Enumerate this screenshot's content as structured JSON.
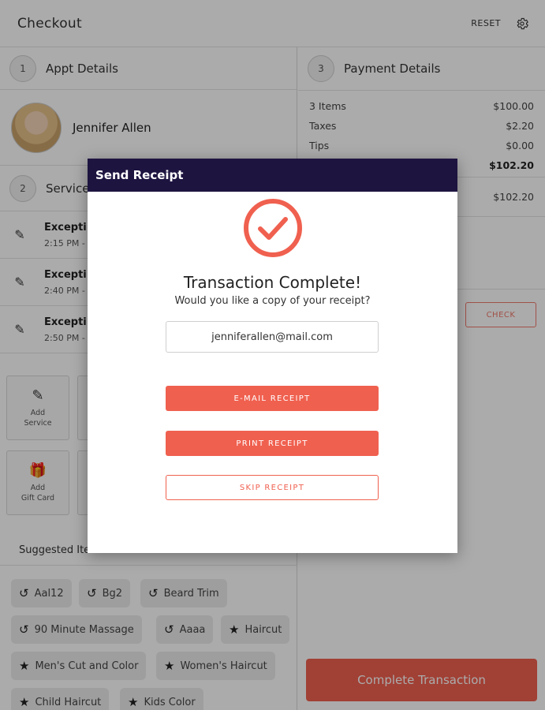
{
  "header": {
    "title": "Checkout",
    "reset_label": "RESET",
    "settings_icon": "gear-icon"
  },
  "appt": {
    "step": "1",
    "title": "Appt Details",
    "client_name": "Jennifer Allen"
  },
  "services": {
    "step": "2",
    "title": "Services",
    "items": [
      {
        "name": "Excepti",
        "time": "2:15 PM -"
      },
      {
        "name": "Excepti",
        "time": "2:40 PM -"
      },
      {
        "name": "Excepti",
        "time": "2:50 PM -"
      }
    ]
  },
  "tiles": [
    {
      "label_line1": "Add",
      "label_line2": "Service",
      "icon": "hairdryer-icon"
    },
    {
      "label_line1": "Add",
      "label_line2": "Gift Card",
      "icon": "gift-card-icon"
    }
  ],
  "suggested": {
    "title": "Suggested Items",
    "chips": [
      {
        "label": "Aal12",
        "icon": "history-icon"
      },
      {
        "label": "Bg2",
        "icon": "history-icon"
      },
      {
        "label": "Beard Trim",
        "icon": "history-icon"
      },
      {
        "label": "90 Minute Massage",
        "icon": "history-icon"
      },
      {
        "label": "Aaaa",
        "icon": "history-icon"
      },
      {
        "label": "Haircut",
        "icon": "star-icon"
      },
      {
        "label": "Men's Cut and Color",
        "icon": "star-icon"
      },
      {
        "label": "Women's Haircut",
        "icon": "star-icon"
      },
      {
        "label": "Child Haircut",
        "icon": "star-icon"
      },
      {
        "label": "Kids Color",
        "icon": "star-icon"
      }
    ]
  },
  "payment": {
    "step": "3",
    "title": "Payment Details",
    "rows": [
      {
        "label": "3 Items",
        "value": "$100.00"
      },
      {
        "label": "Taxes",
        "value": "$2.20"
      },
      {
        "label": "Tips",
        "value": "$0.00"
      },
      {
        "label": "",
        "value": "$102.20"
      }
    ],
    "balance_value": "$102.20",
    "check_label": "CHECK",
    "complete_label": "Complete Transaction"
  },
  "modal": {
    "header": "Send Receipt",
    "title": "Transaction Complete!",
    "subtitle": "Would you like a copy of your receipt?",
    "email_value": "jenniferallen@mail.com",
    "email_button": "E-MAIL RECEIPT",
    "print_button": "PRINT RECEIPT",
    "skip_button": "SKIP RECEIPT",
    "accent_color": "#f0604f",
    "header_color": "#1e1440"
  }
}
